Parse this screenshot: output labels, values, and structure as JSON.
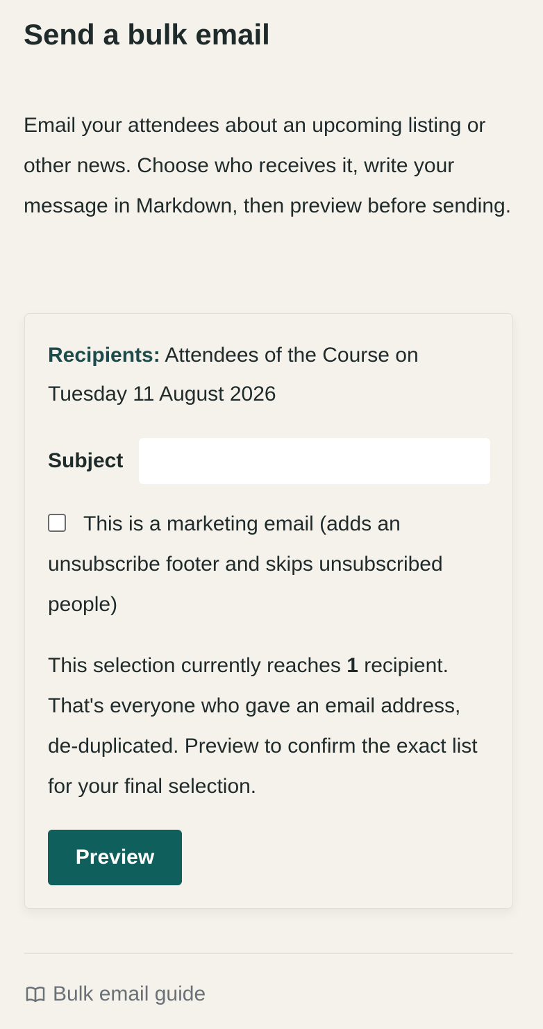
{
  "page": {
    "title": "Send a bulk email",
    "intro": "Email your attendees about an upcoming listing or other news. Choose who receives it, write your message in Markdown, then preview before sending."
  },
  "form": {
    "recipients_label": "Recipients:",
    "recipients_value": "Attendees of the Course on Tuesday 11 August 2026",
    "subject_label": "Subject",
    "subject_value": "",
    "marketing_checked": false,
    "marketing_label": "This is a marketing email (adds an unsubscribe footer and skips unsubscribed people)",
    "reach_prefix": "This selection currently reaches",
    "reach_count": "1",
    "reach_suffix": "recipient. That's everyone who gave an email address, de-duplicated. Preview to confirm the exact list for your final selection.",
    "preview_label": "Preview"
  },
  "footer": {
    "guide_label": "Bulk email guide",
    "guide_icon": "book-icon"
  },
  "colors": {
    "background": "#f5f2ec",
    "primary_button": "#0f5f5c",
    "text": "#1f2a2a",
    "muted_link": "#6a7176"
  }
}
